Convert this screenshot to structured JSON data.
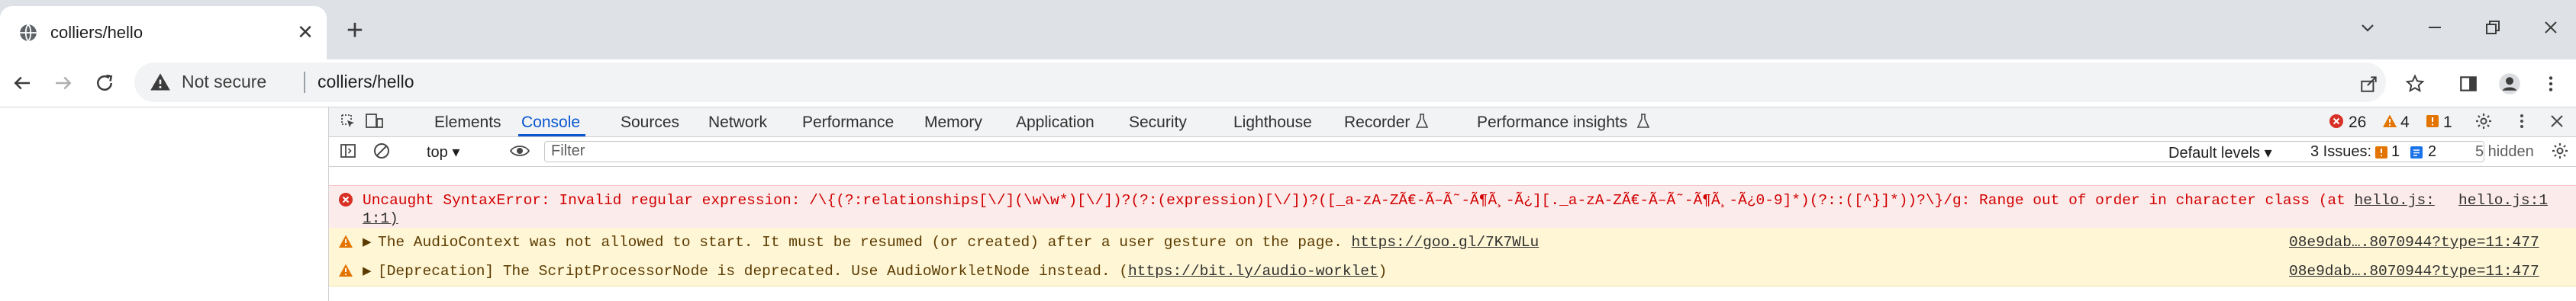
{
  "browser": {
    "tab_title": "colliers/hello",
    "tab_close": "✕",
    "new_tab": "+",
    "address": {
      "security_label": "Not secure",
      "url": "colliers/hello"
    }
  },
  "devtools": {
    "tabs": [
      "Elements",
      "Console",
      "Sources",
      "Network",
      "Performance",
      "Memory",
      "Application",
      "Security",
      "Lighthouse",
      "Recorder",
      "Performance insights"
    ],
    "active_tab": "Console",
    "status": {
      "errors": "26",
      "warnings": "4",
      "issues": "1"
    },
    "filterbar": {
      "context": "top",
      "filter_placeholder": "Filter",
      "levels": "Default levels",
      "issues_label": "3 Issues:",
      "issues_warn": "1",
      "issues_info": "2",
      "hidden": "5 hidden"
    },
    "messages": [
      {
        "level": "error",
        "text_line1": "Uncaught SyntaxError: Invalid regular expression: /\\{(?:relationships[\\/](\\w\\w*)[\\/])?(?:(expression)[\\/])?([_a-zA-ZÃ€-Ã–Ã˜-Ã¶Ã¸-Ã¿][._a-zA-ZÃ€-Ã–Ã˜-Ã¶Ã¸-Ã¿0-9]*)(?::([^}]*))?\\}/g: Range out of order in character class (at",
        "inline_link": "hello.js:",
        "text_line2": "1:1)",
        "source": "hello.js:1"
      },
      {
        "level": "warning",
        "text": "The AudioContext was not allowed to start. It must be resumed (or created) after a user gesture on the page.",
        "link": "https://goo.gl/7K7WLu",
        "source": "08e9dab….8070944?type=11:477"
      },
      {
        "level": "warning",
        "text_prefix": "[Deprecation] The ScriptProcessorNode is deprecated. Use AudioWorkletNode instead. (",
        "link": "https://bit.ly/audio-worklet",
        "text_suffix": ")",
        "source": "08e9dab….8070944?type=11:477"
      }
    ]
  },
  "colors": {
    "accent": "#0b57d0",
    "error": "#d93025",
    "warning": "#e37400",
    "tabstrip": "#dee1e6"
  }
}
